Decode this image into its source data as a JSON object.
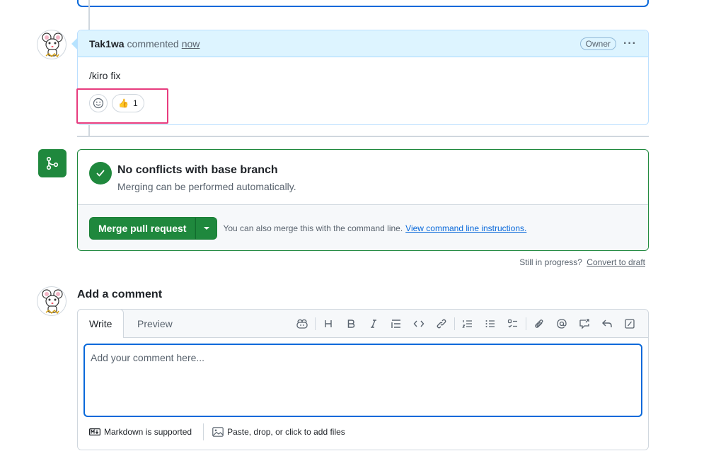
{
  "comment": {
    "author": "Tak1wa",
    "action": "commented",
    "time": "now",
    "badge": "Owner",
    "body": "/kiro fix",
    "reaction_emoji": "👍",
    "reaction_count": "1"
  },
  "merge": {
    "title": "No conflicts with base branch",
    "subtitle": "Merging can be performed automatically.",
    "button_label": "Merge pull request",
    "note": "You can also merge this with the command line.",
    "link": "View command line instructions."
  },
  "draft": {
    "prefix": "Still in progress?",
    "link": "Convert to draft"
  },
  "add_comment": {
    "title": "Add a comment",
    "tabs": {
      "write": "Write",
      "preview": "Preview"
    },
    "placeholder": "Add your comment here...",
    "markdown_note": "Markdown is supported",
    "attach_note": "Paste, drop, or click to add files"
  },
  "colors": {
    "accent": "#0969da",
    "success": "#1f883d",
    "highlight": "#e73c7e"
  }
}
